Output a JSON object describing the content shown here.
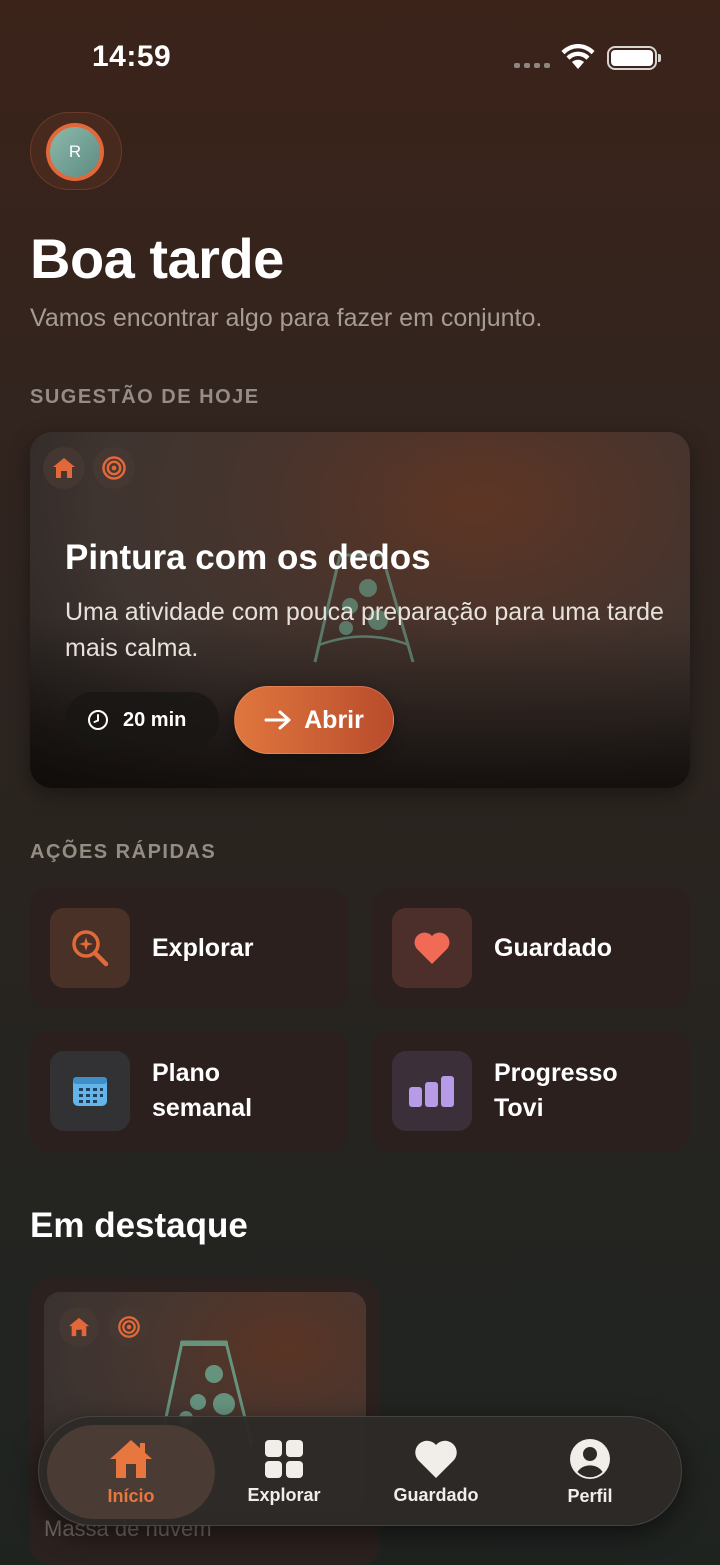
{
  "status_bar": {
    "time": "14:59"
  },
  "avatar": {
    "initial": "R"
  },
  "header": {
    "greeting": "Boa tarde",
    "subtitle": "Vamos encontrar algo para fazer em conjunto."
  },
  "suggestion": {
    "section_label": "SUGESTÃO DE HOJE",
    "title": "Pintura com os dedos",
    "description": "Uma atividade com pouca preparação para uma tarde mais calma.",
    "duration": "20 min",
    "open_label": "Abrir",
    "tags": [
      "home-icon",
      "target-icon"
    ]
  },
  "quick_actions": {
    "section_label": "AÇÕES RÁPIDAS",
    "items": [
      {
        "label": "Explorar",
        "icon": "search-sparkle-icon",
        "color": "#e2693a"
      },
      {
        "label": "Guardado",
        "icon": "heart-icon",
        "color": "#f06a55"
      },
      {
        "label": "Plano semanal",
        "icon": "calendar-icon",
        "color": "#62b5e8"
      },
      {
        "label": "Progresso Tovi",
        "icon": "bar-chart-icon",
        "color": "#b89be8"
      }
    ]
  },
  "featured": {
    "title": "Em destaque",
    "card_title": "Massa de nuvem"
  },
  "tab_bar": {
    "tabs": [
      {
        "label": "Início",
        "icon": "home-icon",
        "active": true
      },
      {
        "label": "Explorar",
        "icon": "grid-icon",
        "active": false
      },
      {
        "label": "Guardado",
        "icon": "heart-icon",
        "active": false
      },
      {
        "label": "Perfil",
        "icon": "profile-icon",
        "active": false
      }
    ]
  },
  "colors": {
    "accent": "#e2683a",
    "background_top": "#3b2319",
    "background_bottom": "#1f2320"
  }
}
